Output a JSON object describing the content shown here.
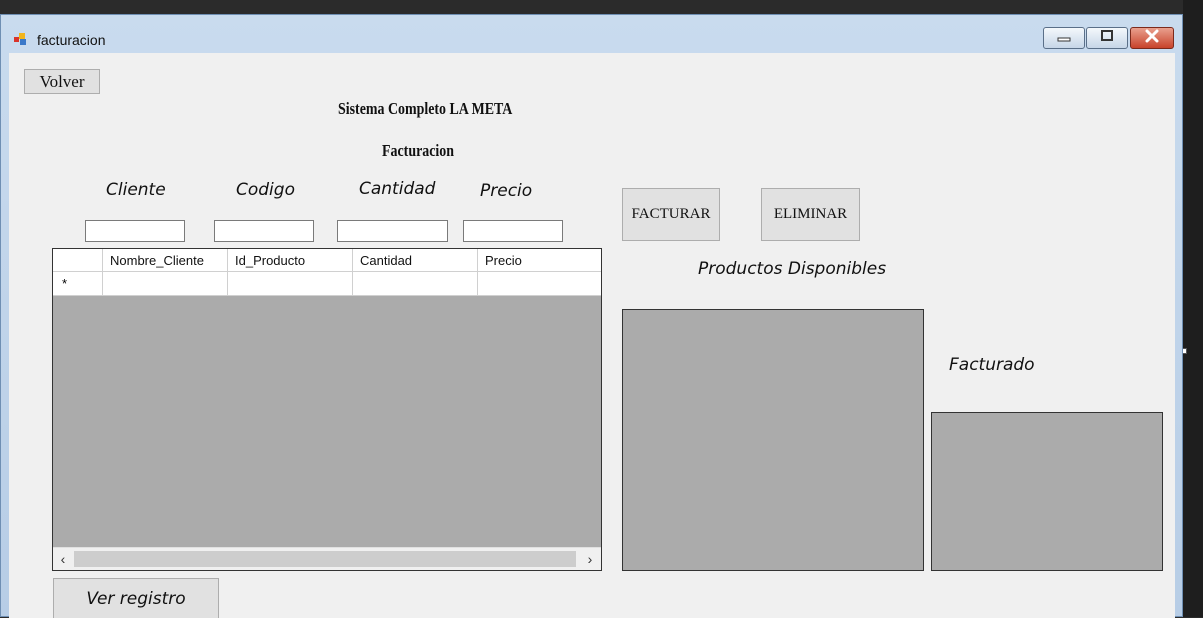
{
  "window": {
    "title": "facturacion",
    "icon": "form-icon",
    "controls": [
      "minimize-icon",
      "maximize-icon",
      "close-icon"
    ]
  },
  "buttons": {
    "volver": "Volver",
    "facturar": "FACTURAR",
    "eliminar": "ELIMINAR",
    "ver_registro": "Ver registro"
  },
  "headings": {
    "system": "Sistema Completo LA META",
    "section": "Facturacion"
  },
  "fields": {
    "cliente": {
      "label": "Cliente",
      "value": ""
    },
    "codigo": {
      "label": "Codigo",
      "value": ""
    },
    "cantidad": {
      "label": "Cantidad",
      "value": ""
    },
    "precio": {
      "label": "Precio",
      "value": ""
    }
  },
  "grid": {
    "columns": [
      "Nombre_Cliente",
      "Id_Producto",
      "Cantidad",
      "Precio"
    ],
    "new_row_marker": "*",
    "rows": [],
    "scroll_left": "‹",
    "scroll_right": "›"
  },
  "panels": {
    "productos_label": "Productos Disponibles",
    "facturado_label": "Facturado"
  },
  "colors": {
    "grid_background": "#ababab",
    "form_background": "#f0f0f0",
    "title_bar": "#c9dbee"
  }
}
